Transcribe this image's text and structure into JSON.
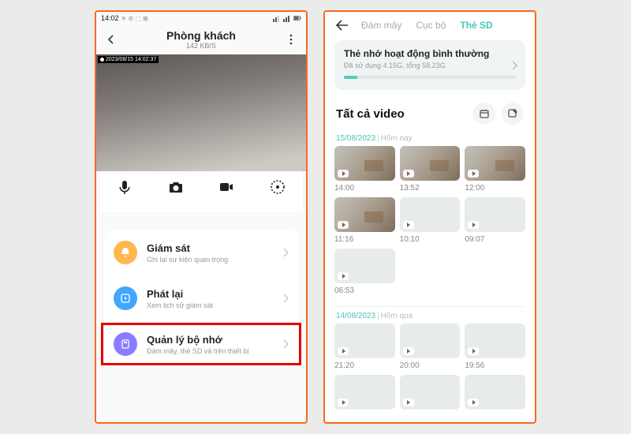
{
  "phone1": {
    "status": {
      "time": "14:02",
      "icons_left": "✕ ⊘ ⬚ ⊞",
      "icons_right": "▤ ▤ ▯"
    },
    "header": {
      "title": "Phòng khách",
      "rate": "142 KB/S"
    },
    "camera_timestamp": "2023/08/15 14:02:37",
    "rows": [
      {
        "icon": "bell",
        "title": "Giám sát",
        "subtitle": "Ghi lại sự kiện quan trọng"
      },
      {
        "icon": "play",
        "title": "Phát lại",
        "subtitle": "Xem lịch sử giám sát"
      },
      {
        "icon": "storage",
        "title": "Quản lý bộ nhớ",
        "subtitle": "Đám mây, thẻ SD và trên thiết bị"
      }
    ]
  },
  "phone2": {
    "tabs": [
      "Đám mây",
      "Cục bộ",
      "Thẻ SD"
    ],
    "sd": {
      "title": "Thẻ nhớ hoạt động bình thường",
      "sub": "Đã sử dụng 4.15G, tổng 58.23G"
    },
    "section_title": "Tất cả video",
    "groups": [
      {
        "date": "15/08/2023",
        "suffix": "Hôm nay",
        "clips": [
          {
            "t": "14:00",
            "k": "room"
          },
          {
            "t": "13:52",
            "k": "room"
          },
          {
            "t": "12:00",
            "k": "room"
          },
          {
            "t": "11:16",
            "k": "room"
          },
          {
            "t": "10:10",
            "k": "gray"
          },
          {
            "t": "09:07",
            "k": "gray"
          },
          {
            "t": "06:53",
            "k": "gray"
          }
        ]
      },
      {
        "date": "14/08/2023",
        "suffix": "Hôm qua",
        "clips": [
          {
            "t": "21:20",
            "k": "gray"
          },
          {
            "t": "20:00",
            "k": "gray"
          },
          {
            "t": "19:56",
            "k": "gray"
          },
          {
            "t": "",
            "k": "gray"
          },
          {
            "t": "",
            "k": "gray"
          },
          {
            "t": "",
            "k": "gray"
          }
        ]
      }
    ]
  }
}
